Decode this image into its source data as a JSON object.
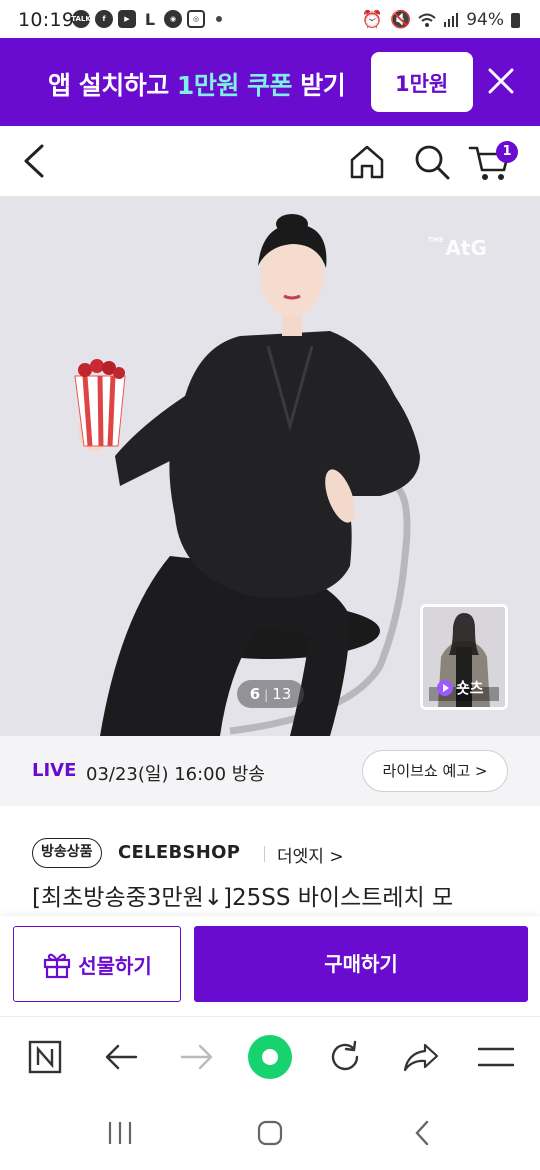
{
  "status_bar": {
    "time": "10:19",
    "left_icons": [
      "talk-icon",
      "facebook-icon",
      "youtube-icon",
      "l-icon",
      "chrome-icon",
      "instagram-icon",
      "dot-icon"
    ],
    "battery": "94%"
  },
  "promo": {
    "text_pre": "앱 설치하고 ",
    "text_highlight": "1만원 쿠폰",
    "text_post": " 받기",
    "coupon_label": "1만원",
    "bg_color": "#6a0ccf",
    "highlight_color": "#7ff0e8"
  },
  "header": {
    "cart_count": "1"
  },
  "hero": {
    "brand_mark_small": "THE",
    "brand_mark": "AtG",
    "image_index": "6",
    "image_total": "13",
    "shorts_label": "숏츠"
  },
  "live": {
    "tag": "LIVE",
    "datetime": "03/23(일) 16:00 방송",
    "preview_button": "라이브쇼 예고 >"
  },
  "product": {
    "badge": "방송상품",
    "shop": "CELEBSHOP",
    "brand": "더엣지 >",
    "title": "[최초방송중3만원↓]25SS 바이스트레치 모"
  },
  "actions": {
    "gift_label": "선물하기",
    "buy_label": "구매하기"
  },
  "accent_color": "#6a0ccf"
}
